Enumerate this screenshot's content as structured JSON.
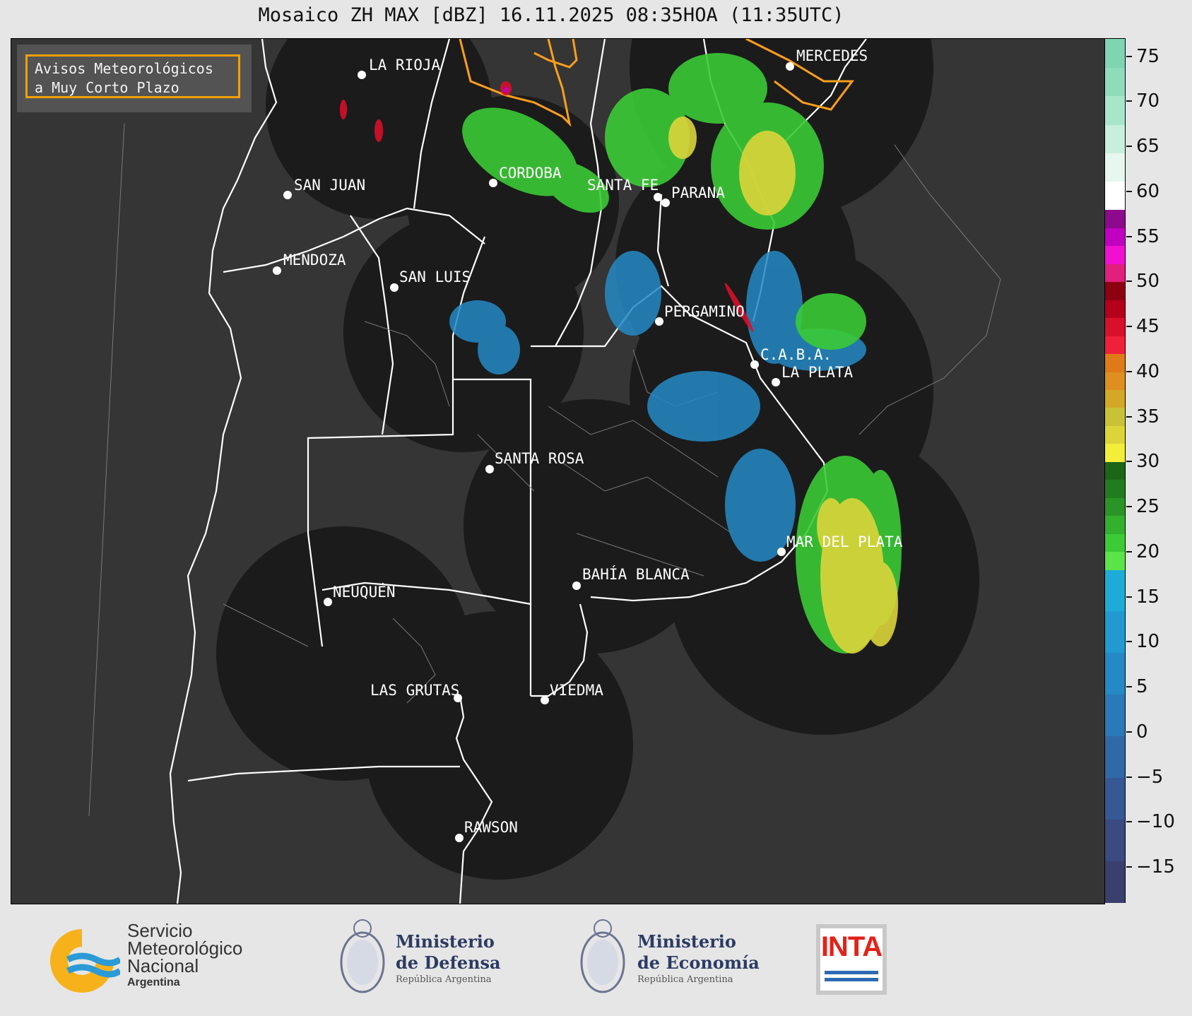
{
  "title": "Mosaico ZH MAX [dBZ] 16.11.2025 08:35HOA (11:35UTC)",
  "warning_box": {
    "line1": "Avisos Meteorológicos",
    "line2": "a Muy Corto Plazo",
    "border_color": "#ffa500"
  },
  "colorbar": {
    "min": -19,
    "max": 77,
    "ticks": [
      "75",
      "70",
      "65",
      "60",
      "55",
      "50",
      "45",
      "40",
      "35",
      "30",
      "25",
      "20",
      "15",
      "10",
      "5",
      "0",
      "−5",
      "−10",
      "−15"
    ],
    "tick_values": [
      75,
      70,
      65,
      60,
      55,
      50,
      45,
      40,
      35,
      30,
      25,
      20,
      15,
      10,
      5,
      0,
      -5,
      -10,
      -15
    ],
    "bands": [
      {
        "from": -19,
        "to": 18,
        "colors": [
          "#3a3f6e",
          "#3b4a80",
          "#365894",
          "#2f69a8",
          "#2a79b8",
          "#2489c5",
          "#219ad1",
          "#1fabd8"
        ]
      },
      {
        "from": 18,
        "to": 30,
        "colors": [
          "#5be34a",
          "#3ccb36",
          "#33b02e",
          "#2a9526",
          "#217c1e",
          "#1c6618"
        ]
      },
      {
        "from": 30,
        "to": 42,
        "colors": [
          "#f2ee3a",
          "#dcd53a",
          "#c9c236",
          "#d3a826",
          "#de8f20",
          "#e07a18"
        ]
      },
      {
        "from": 42,
        "to": 58,
        "colors": [
          "#f0203a",
          "#d8102a",
          "#b4001a",
          "#8c0010",
          "#e0207c",
          "#f010d0",
          "#c000c0",
          "#8e0a8c"
        ]
      },
      {
        "from": 58,
        "to": 77,
        "colors": [
          "#ffffff",
          "#e6f7ef",
          "#c8efdd",
          "#a8e6cc",
          "#8fdcbc",
          "#7fd4b2"
        ]
      }
    ]
  },
  "cities": [
    {
      "name": "LA RIOJA"
    },
    {
      "name": "CORDOBA"
    },
    {
      "name": "SAN JUAN"
    },
    {
      "name": "SANTA FE"
    },
    {
      "name": "PARANA"
    },
    {
      "name": "MERCEDES"
    },
    {
      "name": "MENDOZA"
    },
    {
      "name": "SAN LUIS"
    },
    {
      "name": "PERGAMINO"
    },
    {
      "name": "C.A.B.A."
    },
    {
      "name": "LA PLATA"
    },
    {
      "name": "SANTA ROSA"
    },
    {
      "name": "MAR DEL PLATA"
    },
    {
      "name": "BAHÍA BLANCA"
    },
    {
      "name": "NEUQUÉN"
    },
    {
      "name": "LAS GRUTAS"
    },
    {
      "name": "VIEDMA"
    },
    {
      "name": "RAWSON"
    }
  ],
  "logos": {
    "smn": {
      "line1": "Servicio",
      "line2": "Meteorológico",
      "line3": "Nacional",
      "line4": "Argentina"
    },
    "defensa": {
      "line1": "Ministerio",
      "line2": "de Defensa",
      "line3": "República Argentina"
    },
    "economia": {
      "line1": "Ministerio",
      "line2": "de Economía",
      "line3": "República Argentina"
    },
    "inta": {
      "text": "INTA"
    }
  }
}
